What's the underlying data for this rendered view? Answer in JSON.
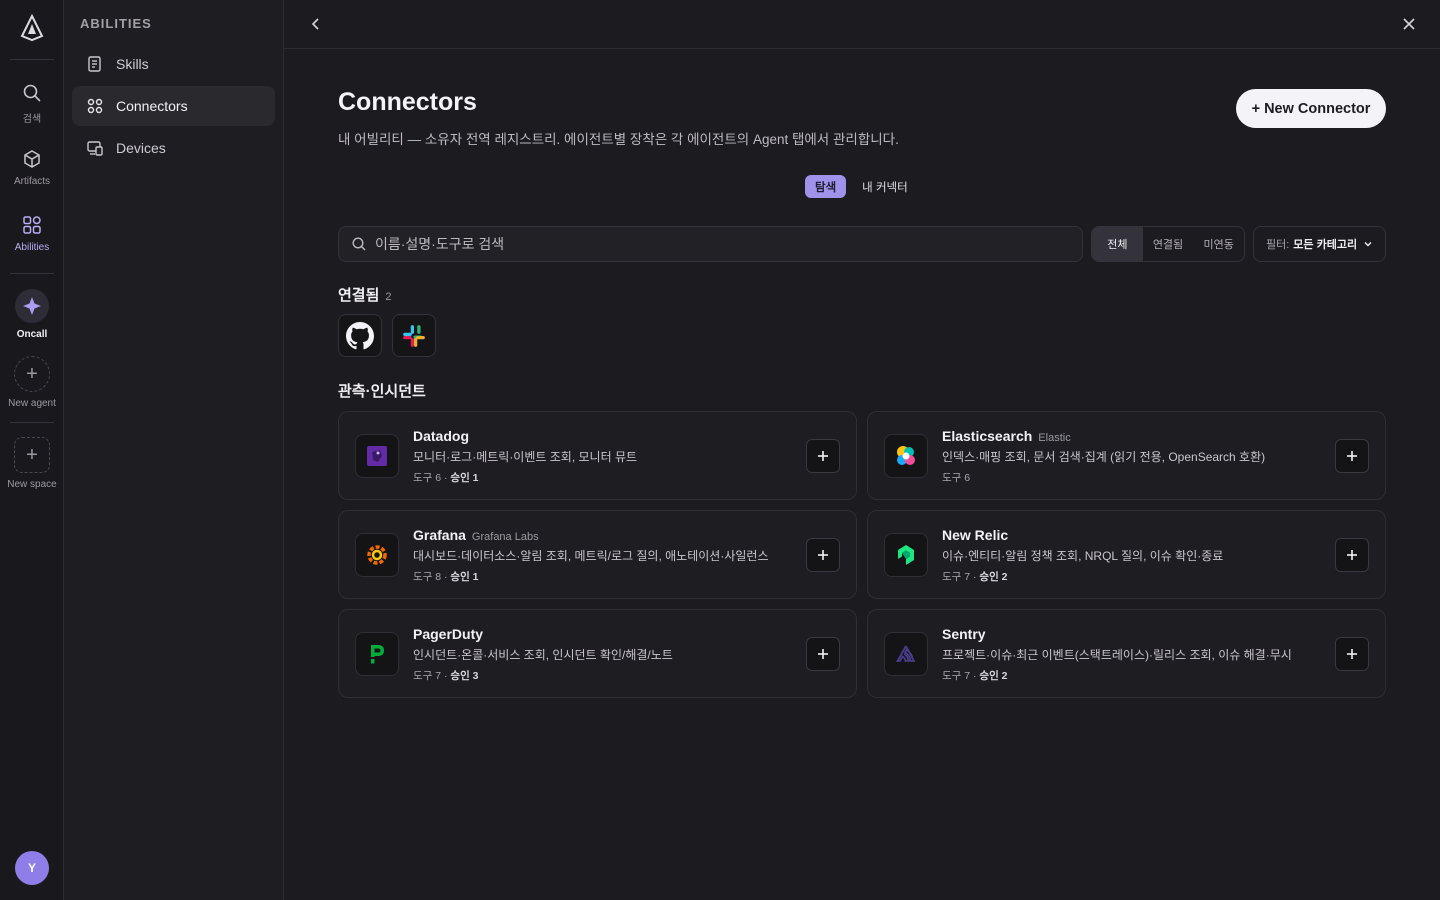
{
  "rail": {
    "items": [
      {
        "label": "검색",
        "icon": "search-icon"
      },
      {
        "label": "Artifacts",
        "icon": "cube-icon"
      },
      {
        "label": "Abilities",
        "icon": "grid-icon"
      },
      {
        "label": "Oncall",
        "icon": "oncall-icon"
      },
      {
        "label": "New agent",
        "icon": "plus-icon"
      },
      {
        "label": "New space",
        "icon": "plus-icon"
      }
    ],
    "avatar": "Y"
  },
  "sidebar": {
    "heading": "ABILITIES",
    "items": [
      {
        "label": "Skills",
        "icon": "skills-icon"
      },
      {
        "label": "Connectors",
        "icon": "grid-icon",
        "active": true
      },
      {
        "label": "Devices",
        "icon": "devices-icon"
      }
    ]
  },
  "header": {
    "title": "Connectors",
    "subtitle": "내 어빌리티 — 소유자 전역 레지스트리. 에이전트별 장착은 각 에이전트의 Agent 탭에서 관리합니다.",
    "new_button": "+ New Connector"
  },
  "tabs": [
    "탐색",
    "내 커넥터"
  ],
  "search": {
    "placeholder": "이름·설명·도구로 검색"
  },
  "segments": [
    "전체",
    "연결됨",
    "미연동"
  ],
  "filter": {
    "label": "필터:",
    "value": "모든 카테고리"
  },
  "connected": {
    "title": "연결됨",
    "count": "2",
    "items": [
      "GitHub",
      "Slack"
    ]
  },
  "section": {
    "title": "관측·인시던트"
  },
  "cards": [
    {
      "name": "Datadog",
      "vendor": "",
      "desc": "모니터·로그·메트릭·이벤트 조회, 모니터 뮤트",
      "meta_tools": "도구 6",
      "meta_approval": "승인 1"
    },
    {
      "name": "Elasticsearch",
      "vendor": "Elastic",
      "desc": "인덱스·매핑 조회, 문서 검색·집계 (읽기 전용, OpenSearch 호환)",
      "meta_tools": "도구 6",
      "meta_approval": ""
    },
    {
      "name": "Grafana",
      "vendor": "Grafana Labs",
      "desc": "대시보드·데이터소스·알림 조회, 메트릭/로그 질의, 애노테이션·사일런스",
      "meta_tools": "도구 8",
      "meta_approval": "승인 1"
    },
    {
      "name": "New Relic",
      "vendor": "",
      "desc": "이슈·엔티티·알림 정책 조회, NRQL 질의, 이슈 확인·종료",
      "meta_tools": "도구 7",
      "meta_approval": "승인 2"
    },
    {
      "name": "PagerDuty",
      "vendor": "",
      "desc": "인시던트·온콜·서비스 조회, 인시던트 확인/해결/노트",
      "meta_tools": "도구 7",
      "meta_approval": "승인 3"
    },
    {
      "name": "Sentry",
      "vendor": "",
      "desc": "프로젝트·이슈·최근 이벤트(스택트레이스)·릴리스 조회, 이슈 해결·무시",
      "meta_tools": "도구 7",
      "meta_approval": "승인 2"
    }
  ],
  "colors": {
    "accent": "#9f92ea",
    "avatar": "#8f7ee8",
    "background": "#1c1b1f"
  }
}
